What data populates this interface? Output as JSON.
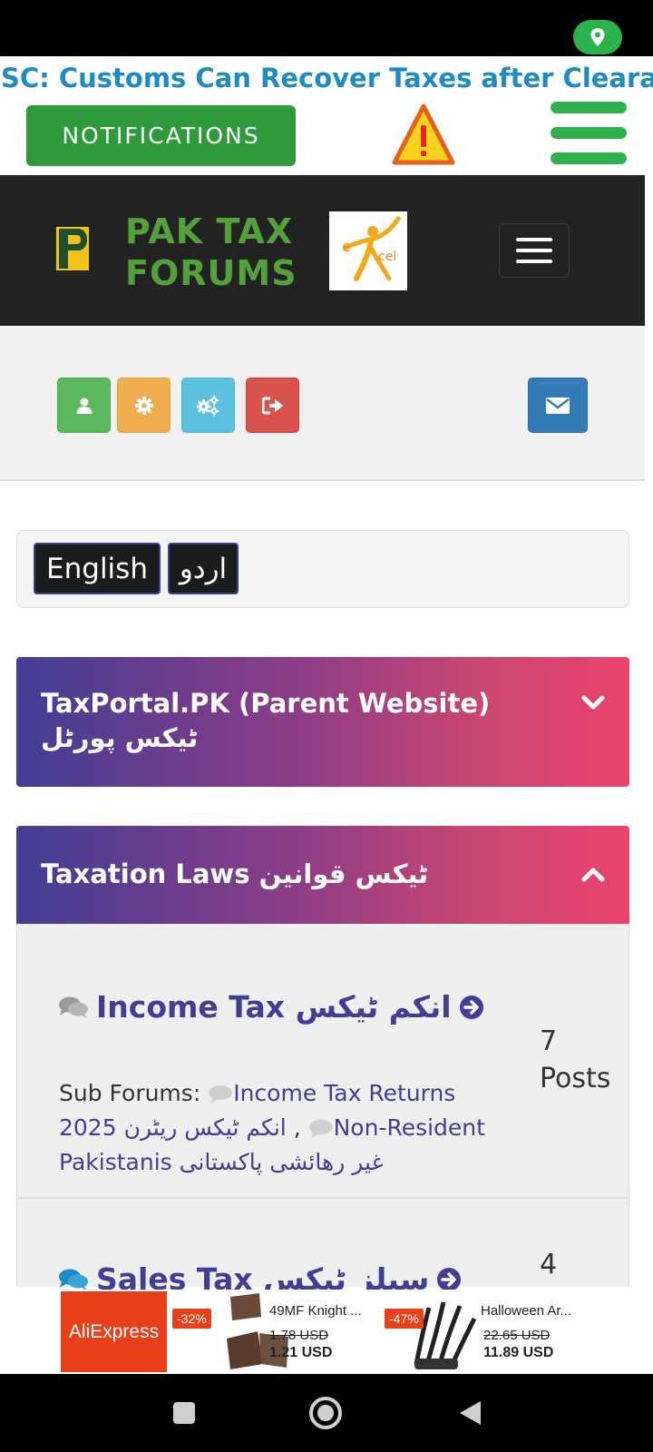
{
  "ticker": {
    "text": "SC: Customs Can Recover Taxes after Cleara . ."
  },
  "top_actions": {
    "notifications_label": "NOTIFICATIONS"
  },
  "header": {
    "site_title_line1": "PAK TAX",
    "site_title_line2": "FORUMS"
  },
  "toolbar": {
    "buttons": [
      {
        "icon": "user-icon",
        "color": "#5cb85c"
      },
      {
        "icon": "gear-icon",
        "color": "#f0ad4e"
      },
      {
        "icon": "gears-icon",
        "color": "#5bc0de"
      },
      {
        "icon": "logout-icon",
        "color": "#d9534f"
      },
      {
        "icon": "mail-icon",
        "color": "#337ab7"
      }
    ]
  },
  "language": {
    "english": "English",
    "urdu": "اردو"
  },
  "categories": [
    {
      "title": "TaxPortal.PK (Parent Website) ٹیکس پورٹل",
      "state": "collapsed"
    },
    {
      "title": "Taxation Laws ٹیکس قوانین",
      "state": "expanded"
    }
  ],
  "forums": [
    {
      "title": "Income Tax انکم ٹیکس",
      "count": "7",
      "count_label": "Posts",
      "subforums_label": "Sub Forums:",
      "subforums": [
        "Income Tax Returns 2025 انکم ٹیکس ریٹرن",
        "Non-Resident Pakistanis غیر رھائشی پاکستانی"
      ],
      "separator": ","
    },
    {
      "title": "Sales Tax سیلز ٹیکس",
      "count": "4"
    }
  ],
  "ad": {
    "brand": "AliExpress",
    "products": [
      {
        "discount": "-32%",
        "name": "49MF Knight ...",
        "old_price": "1.78 USD",
        "new_price": "1.21 USD"
      },
      {
        "discount": "-47%",
        "name": "Halloween Ar...",
        "old_price": "22.65 USD",
        "new_price": "11.89 USD"
      }
    ]
  },
  "colors": {
    "accent_green": "#2e9a3b",
    "header_bg": "#222222",
    "title_green": "#53a03c",
    "forum_link": "#433d94",
    "gradient_start": "#433d94",
    "gradient_end": "#ea436c"
  }
}
